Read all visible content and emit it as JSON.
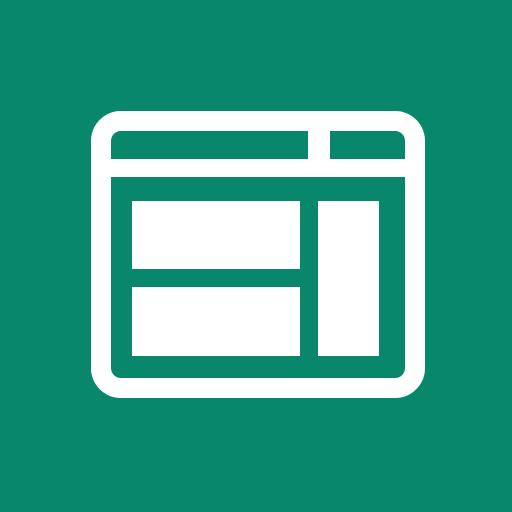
{
  "app_icon": {
    "icon_name": "layout-window-icon",
    "colors": {
      "background": "#08876a",
      "glyph": "#ffffff"
    },
    "glyph_parts": [
      "window-frame",
      "title-bar",
      "title-bar-divider",
      "panel-top-left",
      "panel-bottom-left",
      "panel-right"
    ]
  }
}
